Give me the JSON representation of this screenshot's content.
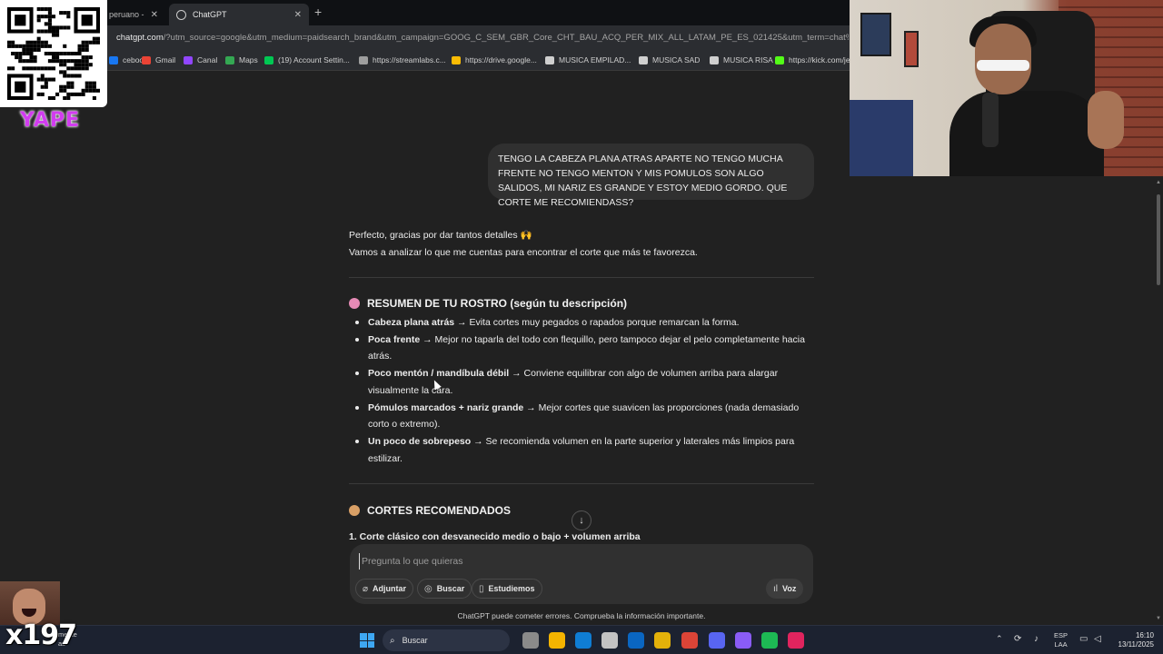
{
  "browser": {
    "tabs": [
      {
        "label": "peruano -",
        "active": false
      },
      {
        "label": "ChatGPT",
        "active": true
      }
    ],
    "new_tab_label": "+",
    "close_glyph": "✕",
    "url_domain": "chatgpt.com",
    "url_rest": "/?utm_source=google&utm_medium=paidsearch_brand&utm_campaign=GOOG_C_SEM_GBR_Core_CHT_BAU_ACQ_PER_MIX_ALL_LATAM_PE_ES_021425&utm_term=chat%20gpt&utm_",
    "bookmarks": [
      {
        "label": "cebook",
        "color": "#1877f2"
      },
      {
        "label": "Gmail",
        "color": "#ea4335"
      },
      {
        "label": "Canal",
        "color": "#9146ff"
      },
      {
        "label": "Maps",
        "color": "#34a853"
      },
      {
        "label": "(19) Account Settin...",
        "color": "#00c853"
      },
      {
        "label": "https://streamlabs.c...",
        "color": "#9e9e9e"
      },
      {
        "label": "https://drive.google...",
        "color": "#fbbc04"
      },
      {
        "label": "MUSICA EMPILAD...",
        "color": "#cfcfcf"
      },
      {
        "label": "MUSICA SAD",
        "color": "#cfcfcf"
      },
      {
        "label": "MUSICA RISA",
        "color": "#cfcfcf"
      },
      {
        "label": "https://kick.com/jef",
        "color": "#53fc18"
      }
    ]
  },
  "overlays": {
    "yape_label": "YAPE",
    "multiplier": "x197"
  },
  "chat": {
    "user_message": "TENGO LA CABEZA PLANA ATRAS APARTE NO TENGO MUCHA FRENTE NO TENGO MENTON Y MIS POMULOS SON ALGO SALIDOS, MI NARIZ ES GRANDE Y ESTOY MEDIO GORDO. QUE CORTE ME RECOMIENDASS?",
    "intro_line1": "Perfecto, gracias por dar tantos detalles 🙌",
    "intro_line2": "Vamos a analizar lo que me cuentas para encontrar el corte que más te favorezca.",
    "summary_heading": "RESUMEN DE TU ROSTRO (según tu descripción)",
    "summary_items": [
      {
        "bold": "Cabeza plana atrás",
        "text": " → Evita cortes muy pegados o rapados porque remarcan la forma."
      },
      {
        "bold": "Poca frente",
        "text": " → Mejor no taparla del todo con flequillo, pero tampoco dejar el pelo completamente hacia atrás."
      },
      {
        "bold": "Poco mentón / mandíbula débil",
        "text": " → Conviene equilibrar con algo de volumen arriba para alargar visualmente la cara."
      },
      {
        "bold": "Pómulos marcados + nariz grande",
        "text": " → Mejor cortes que suavicen las proporciones (nada demasiado corto o extremo)."
      },
      {
        "bold": "Un poco de sobrepeso",
        "text": " → Se recomienda volumen en la parte superior y laterales más limpios para estilizar."
      }
    ],
    "cuts_heading": "CORTES RECOMENDADOS",
    "first_recommendation": "1. Corte clásico con desvanecido medio o bajo + volumen arriba",
    "scroll_down_glyph": "↓"
  },
  "composer": {
    "placeholder": "Pregunta lo que quieras",
    "attach_label": "Adjuntar",
    "search_label": "Buscar",
    "study_label": "Estudiemos",
    "voice_label": "Voz"
  },
  "disclaimer": "ChatGPT puede cometer errores. Comprueba la información importante.",
  "taskbar": {
    "weather_line1": "mente",
    "weather_line2": "as",
    "search_label": "Buscar",
    "lang_line1": "ESP",
    "lang_line2": "LAA",
    "time": "16:10",
    "date": "13/11/2025",
    "app_colors": [
      "#8a8a8a",
      "#f4b400",
      "#0f7dd4",
      "#c3c3c3",
      "#0a66c2",
      "#e3b10a",
      "#db4437",
      "#5865f2",
      "#8a5cf6",
      "#1db954",
      "#e0245e"
    ]
  },
  "icons": {
    "attach": "paperclip-icon",
    "search": "globe-icon",
    "study": "book-icon",
    "voice": "waveform-icon",
    "summary_emoji": "brain-icon",
    "cuts_emoji": "person-haircut-icon"
  },
  "colors": {
    "app_bg": "#212121",
    "bubble_bg": "#303030",
    "yape": "#d23cf0"
  }
}
